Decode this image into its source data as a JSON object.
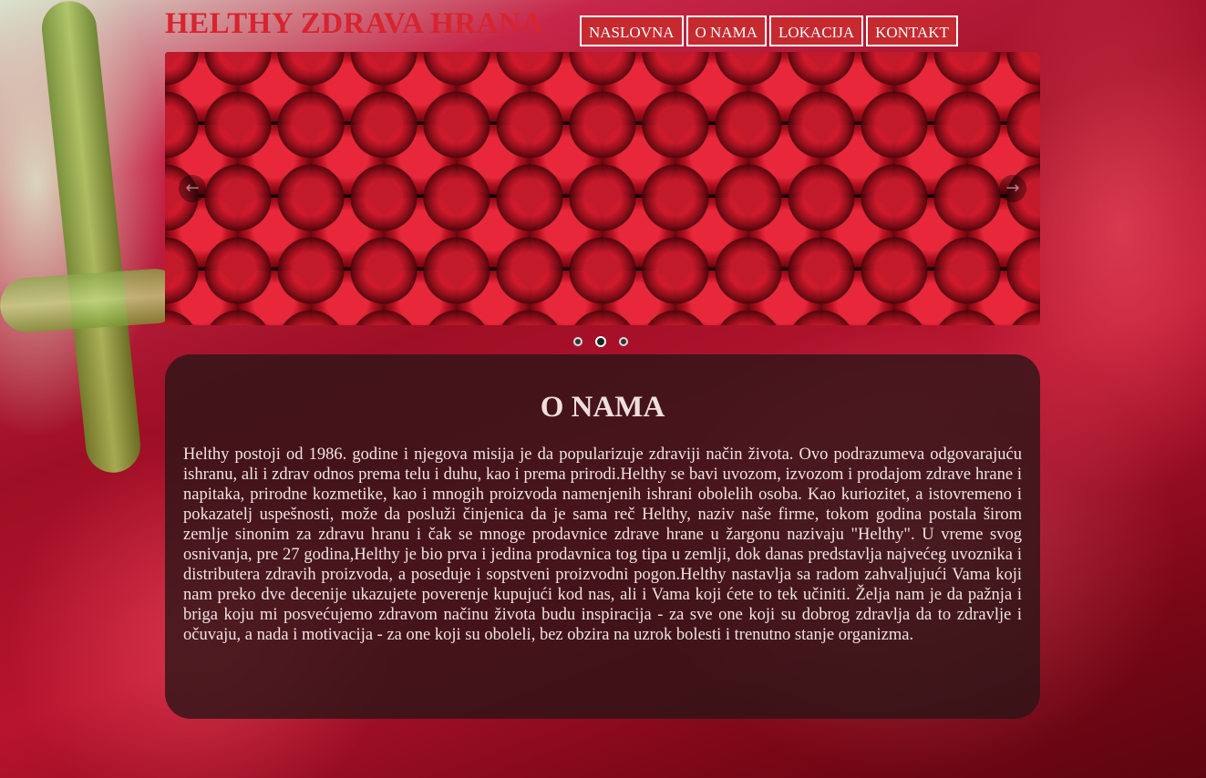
{
  "header": {
    "site_title": "HELTHY ZDRAVA HRANA"
  },
  "nav": {
    "items": [
      {
        "label": "NASLOVNA"
      },
      {
        "label": "O NAMA"
      },
      {
        "label": "LOKACIJA"
      },
      {
        "label": "KONTAKT"
      }
    ]
  },
  "slider": {
    "prev_icon": "arrow-left-icon",
    "next_icon": "arrow-right-icon",
    "slide_count": 3,
    "active_slide": 2
  },
  "main": {
    "title": "O NAMA",
    "text": "Helthy postoji od 1986. godine i njegova misija je da popularise zdraviji nacin zivota."
  },
  "colors": {
    "accent": "#c62a2f",
    "title": "#d7242f",
    "panel": "#281416"
  }
}
